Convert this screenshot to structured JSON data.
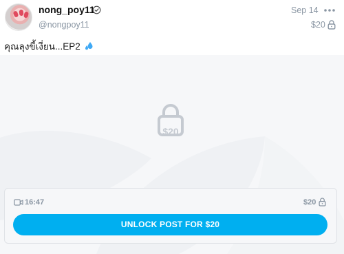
{
  "post": {
    "username": "nong_poy11",
    "handle": "@nongpoy11",
    "date": "Sep 14",
    "price": "$20",
    "caption": "คุณลุงขี้เงี่ยน...EP2",
    "icons": {
      "verified": "verified-check-icon",
      "more": "more-options-icon",
      "lock": "lock-icon",
      "video": "video-icon",
      "droplets": "sweat-droplets-icon"
    }
  },
  "locked_media": {
    "lock_price": "$20",
    "duration": "16:47",
    "price": "$20",
    "unlock_label": "UNLOCK POST FOR $20"
  },
  "colors": {
    "accent": "#00aff0",
    "muted_text": "#8a96a3",
    "locked_bg": "#f6f7f9"
  }
}
